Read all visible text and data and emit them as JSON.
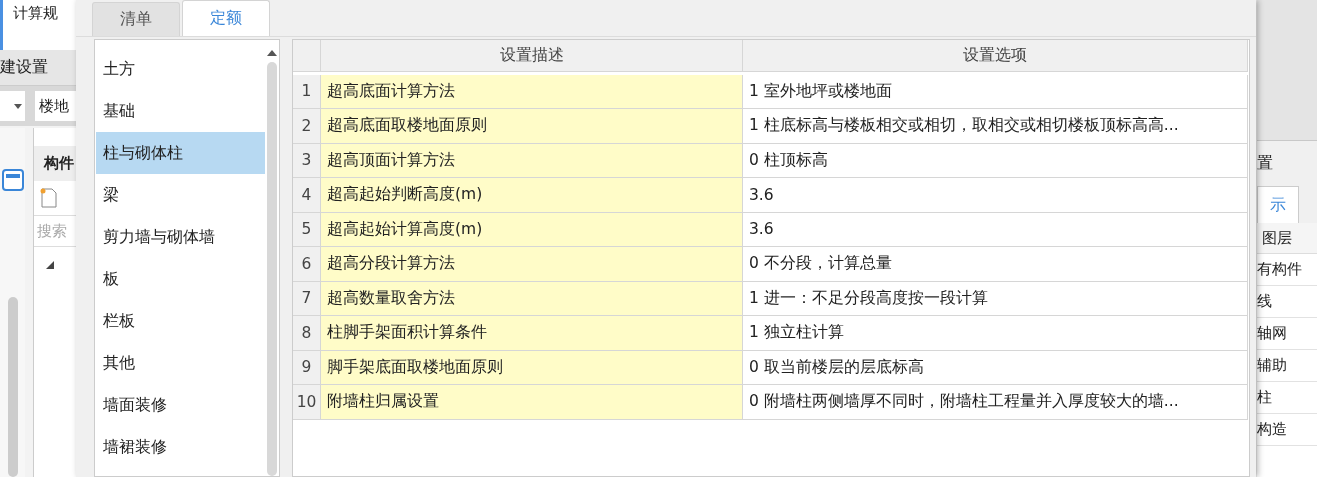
{
  "background_app": {
    "left": {
      "ribbon_tab": "计算规",
      "section_title": "建设置",
      "floor_field": "楼地",
      "panel_title": "构件",
      "search": {
        "placeholder": "搜索"
      }
    },
    "right": {
      "section_title": "置",
      "tab": {
        "label": "示",
        "selected": true
      },
      "list_header": "图层",
      "items": [
        "有构件",
        "线",
        "轴网",
        "辅助",
        "柱",
        "构造"
      ]
    }
  },
  "dialog": {
    "tabs": [
      {
        "label": "清单",
        "selected": false
      },
      {
        "label": "定额",
        "selected": true
      }
    ],
    "categories": [
      {
        "label": "土方",
        "selected": false
      },
      {
        "label": "基础",
        "selected": false
      },
      {
        "label": "柱与砌体柱",
        "selected": true
      },
      {
        "label": "梁",
        "selected": false
      },
      {
        "label": "剪力墙与砌体墙",
        "selected": false
      },
      {
        "label": "板",
        "selected": false
      },
      {
        "label": "栏板",
        "selected": false
      },
      {
        "label": "其他",
        "selected": false
      },
      {
        "label": "墙面装修",
        "selected": false
      },
      {
        "label": "墙裙装修",
        "selected": false
      }
    ],
    "table": {
      "columns": [
        "设置描述",
        "设置选项"
      ],
      "rows": [
        {
          "index": "1",
          "description": "超高底面计算方法",
          "option": "1 室外地坪或楼地面"
        },
        {
          "index": "2",
          "description": "超高底面取楼地面原则",
          "option": "1 柱底标高与楼板相交或相切，取相交或相切楼板顶标高高..."
        },
        {
          "index": "3",
          "description": "超高顶面计算方法",
          "option": "0 柱顶标高"
        },
        {
          "index": "4",
          "description": "超高起始判断高度(m)",
          "option": "3.6"
        },
        {
          "index": "5",
          "description": "超高起始计算高度(m)",
          "option": "3.6"
        },
        {
          "index": "6",
          "description": "超高分段计算方法",
          "option": "0 不分段，计算总量"
        },
        {
          "index": "7",
          "description": "超高数量取舍方法",
          "option": "1 进一：不足分段高度按一段计算"
        },
        {
          "index": "8",
          "description": "柱脚手架面积计算条件",
          "option": "1 独立柱计算"
        },
        {
          "index": "9",
          "description": "脚手架底面取楼地面原则",
          "option": "0 取当前楼层的层底标高"
        },
        {
          "index": "10",
          "description": "附墙柱归属设置",
          "option": "0 附墙柱两侧墙厚不同时，附墙柱工程量并入厚度较大的墙..."
        }
      ]
    }
  }
}
